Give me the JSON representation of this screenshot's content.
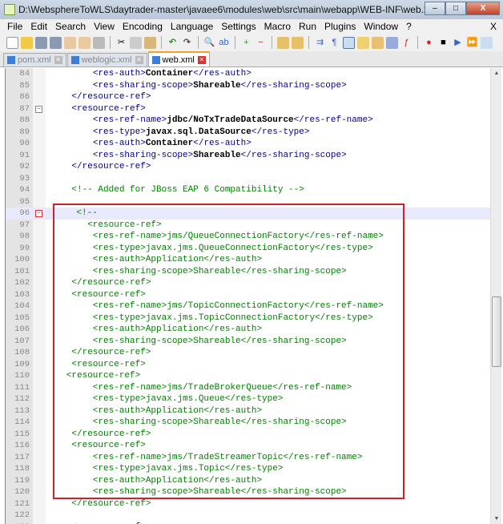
{
  "window": {
    "title": "D:\\WebsphereToWLS\\daytrader-master\\javaee6\\modules\\web\\src\\main\\webapp\\WEB-INF\\web.xml - Notepad++",
    "minimize": "–",
    "maximize": "□",
    "close": "X"
  },
  "menu": [
    "File",
    "Edit",
    "Search",
    "View",
    "Encoding",
    "Language",
    "Settings",
    "Macro",
    "Run",
    "Plugins",
    "Window",
    "?"
  ],
  "menu_close": "X",
  "tabs": [
    {
      "label": "pom.xml",
      "active": false
    },
    {
      "label": "weblogic.xml",
      "active": false
    },
    {
      "label": "web.xml",
      "active": true
    }
  ],
  "colors": {
    "highlight_box": "#d0202a",
    "tag": "#00008b",
    "comment": "#008000"
  },
  "lines": [
    {
      "n": "84",
      "s": [
        [
          "        ",
          "txt"
        ],
        [
          "<res-auth>",
          "tag"
        ],
        [
          "Container",
          "txt"
        ],
        [
          "</res-auth>",
          "tag"
        ]
      ]
    },
    {
      "n": "85",
      "s": [
        [
          "        ",
          "txt"
        ],
        [
          "<res-sharing-scope>",
          "tag"
        ],
        [
          "Shareable",
          "txt"
        ],
        [
          "</res-sharing-scope>",
          "tag"
        ]
      ]
    },
    {
      "n": "86",
      "s": [
        [
          "    ",
          "txt"
        ],
        [
          "</resource-ref>",
          "tag"
        ]
      ]
    },
    {
      "n": "87",
      "fold": "-",
      "s": [
        [
          "    ",
          "txt"
        ],
        [
          "<resource-ref>",
          "tag"
        ]
      ]
    },
    {
      "n": "88",
      "s": [
        [
          "        ",
          "txt"
        ],
        [
          "<res-ref-name>",
          "tag"
        ],
        [
          "jdbc/NoTxTradeDataSource",
          "txt"
        ],
        [
          "</res-ref-name>",
          "tag"
        ]
      ]
    },
    {
      "n": "89",
      "s": [
        [
          "        ",
          "txt"
        ],
        [
          "<res-type>",
          "tag"
        ],
        [
          "javax.sql.DataSource",
          "txt"
        ],
        [
          "</res-type>",
          "tag"
        ]
      ]
    },
    {
      "n": "90",
      "s": [
        [
          "        ",
          "txt"
        ],
        [
          "<res-auth>",
          "tag"
        ],
        [
          "Container",
          "txt"
        ],
        [
          "</res-auth>",
          "tag"
        ]
      ]
    },
    {
      "n": "91",
      "s": [
        [
          "        ",
          "txt"
        ],
        [
          "<res-sharing-scope>",
          "tag"
        ],
        [
          "Shareable",
          "txt"
        ],
        [
          "</res-sharing-scope>",
          "tag"
        ]
      ]
    },
    {
      "n": "92",
      "s": [
        [
          "    ",
          "txt"
        ],
        [
          "</resource-ref>",
          "tag"
        ]
      ]
    },
    {
      "n": "93",
      "s": []
    },
    {
      "n": "94",
      "s": [
        [
          "    <!-- Added for JBoss EAP 6 Compatibility -->",
          "cmt"
        ]
      ]
    },
    {
      "n": "95",
      "s": []
    },
    {
      "n": "96",
      "fold": "-",
      "red": true,
      "cur": true,
      "s": [
        [
          "    <!--",
          "cmt"
        ]
      ]
    },
    {
      "n": "97",
      "s": [
        [
          "       <resource-ref>",
          "cmt"
        ]
      ]
    },
    {
      "n": "98",
      "s": [
        [
          "        <res-ref-name>jms/QueueConnectionFactory</res-ref-name>",
          "cmt"
        ]
      ]
    },
    {
      "n": "99",
      "s": [
        [
          "        <res-type>javax.jms.QueueConnectionFactory</res-type>",
          "cmt"
        ]
      ]
    },
    {
      "n": "100",
      "s": [
        [
          "        <res-auth>Application</res-auth>",
          "cmt"
        ]
      ]
    },
    {
      "n": "101",
      "s": [
        [
          "        <res-sharing-scope>Shareable</res-sharing-scope>",
          "cmt"
        ]
      ]
    },
    {
      "n": "102",
      "s": [
        [
          "    </resource-ref>",
          "cmt"
        ]
      ]
    },
    {
      "n": "103",
      "s": [
        [
          "    <resource-ref>",
          "cmt"
        ]
      ]
    },
    {
      "n": "104",
      "s": [
        [
          "        <res-ref-name>jms/TopicConnectionFactory</res-ref-name>",
          "cmt"
        ]
      ]
    },
    {
      "n": "105",
      "s": [
        [
          "        <res-type>javax.jms.TopicConnectionFactory</res-type>",
          "cmt"
        ]
      ]
    },
    {
      "n": "106",
      "s": [
        [
          "        <res-auth>Application</res-auth>",
          "cmt"
        ]
      ]
    },
    {
      "n": "107",
      "s": [
        [
          "        <res-sharing-scope>Shareable</res-sharing-scope>",
          "cmt"
        ]
      ]
    },
    {
      "n": "108",
      "s": [
        [
          "    </resource-ref>",
          "cmt"
        ]
      ]
    },
    {
      "n": "109",
      "s": [
        [
          "    <resource-ref>",
          "cmt"
        ]
      ]
    },
    {
      "n": "110",
      "s": [
        [
          "   <resource-ref>",
          "cmt"
        ]
      ]
    },
    {
      "n": "111",
      "s": [
        [
          "        <res-ref-name>jms/TradeBrokerQueue</res-ref-name>",
          "cmt"
        ]
      ]
    },
    {
      "n": "112",
      "s": [
        [
          "        <res-type>javax.jms.Queue</res-type>",
          "cmt"
        ]
      ]
    },
    {
      "n": "113",
      "s": [
        [
          "        <res-auth>Application</res-auth>",
          "cmt"
        ]
      ]
    },
    {
      "n": "114",
      "s": [
        [
          "        <res-sharing-scope>Shareable</res-sharing-scope>",
          "cmt"
        ]
      ]
    },
    {
      "n": "115",
      "s": [
        [
          "    </resource-ref>",
          "cmt"
        ]
      ]
    },
    {
      "n": "116",
      "s": [
        [
          "    <resource-ref>",
          "cmt"
        ]
      ]
    },
    {
      "n": "117",
      "s": [
        [
          "        <res-ref-name>jms/TradeStreamerTopic</res-ref-name>",
          "cmt"
        ]
      ]
    },
    {
      "n": "118",
      "s": [
        [
          "        <res-type>javax.jms.Topic</res-type>",
          "cmt"
        ]
      ]
    },
    {
      "n": "119",
      "s": [
        [
          "        <res-auth>Application</res-auth>",
          "cmt"
        ]
      ]
    },
    {
      "n": "120",
      "s": [
        [
          "        <res-sharing-scope>Shareable</res-sharing-scope>",
          "cmt"
        ]
      ]
    },
    {
      "n": "121",
      "s": [
        [
          "    </resource-ref>",
          "cmt"
        ]
      ]
    },
    {
      "n": "122",
      "s": []
    },
    {
      "n": "123",
      "s": [
        [
          "    ",
          "txt"
        ],
        [
          "<resource-ref>",
          "tag"
        ]
      ]
    }
  ]
}
